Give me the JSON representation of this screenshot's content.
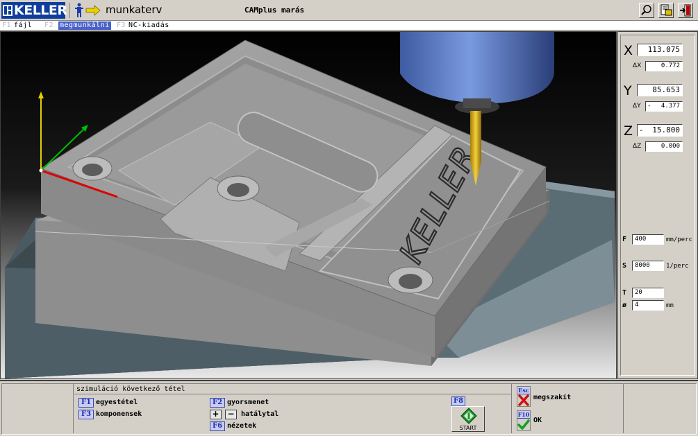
{
  "titlebar": {
    "logo_text": "KELLER",
    "app_name": "munkaterv",
    "window_title": "CAMplus marás",
    "icons": [
      "zoom-icon",
      "print-icon",
      "exit-icon"
    ]
  },
  "menu": {
    "items": [
      {
        "key": "F1",
        "label": "fájl"
      },
      {
        "key": "F2",
        "label": "megmunkálni"
      },
      {
        "key": "F3",
        "label": "NC-kiadás"
      }
    ],
    "active_index": 1
  },
  "viewport": {
    "engraved_text": "KELLER",
    "colors": {
      "part": "#9a9a9a",
      "fixture": "#4e6068",
      "tool_holder": "#5a7ac0",
      "tool": "#d8b020",
      "axis_x": "#e00000",
      "axis_y": "#00c000",
      "axis_z": "#e0d000"
    }
  },
  "coords": {
    "x": {
      "label": "X",
      "sign": "",
      "value": "113.075",
      "delta_label": "ΔX",
      "delta_sign": "",
      "delta": "0.772"
    },
    "y": {
      "label": "Y",
      "sign": "",
      "value": "85.653",
      "delta_label": "ΔY",
      "delta_sign": "-",
      "delta": "4.377"
    },
    "z": {
      "label": "Z",
      "sign": "-",
      "value": "15.800",
      "delta_label": "ΔZ",
      "delta_sign": "",
      "delta": "0.000"
    }
  },
  "params": {
    "f": {
      "label": "F",
      "value": "400",
      "unit": "mm/perc"
    },
    "s": {
      "label": "S",
      "value": "8000",
      "unit": "1/perc"
    },
    "t": {
      "label": "T",
      "value": "20",
      "unit": ""
    },
    "d": {
      "label": "ø",
      "value": "4",
      "unit": "mm"
    }
  },
  "bottom": {
    "title": "szimuláció következő tétel",
    "f1": {
      "key": "F1",
      "label": "egyestétel"
    },
    "f3": {
      "key": "F3",
      "label": "komponensek"
    },
    "f2": {
      "key": "F2",
      "label": "gyorsmenet"
    },
    "plus": "+",
    "minus": "−",
    "pm_label": "hatálytal",
    "f6": {
      "key": "F6",
      "label": "nézetek"
    },
    "f8": {
      "key": "F8"
    },
    "start_label": "START",
    "esc": {
      "key": "Esc",
      "label": "megszakít"
    },
    "f10": {
      "key": "F10",
      "label": "OK"
    }
  }
}
